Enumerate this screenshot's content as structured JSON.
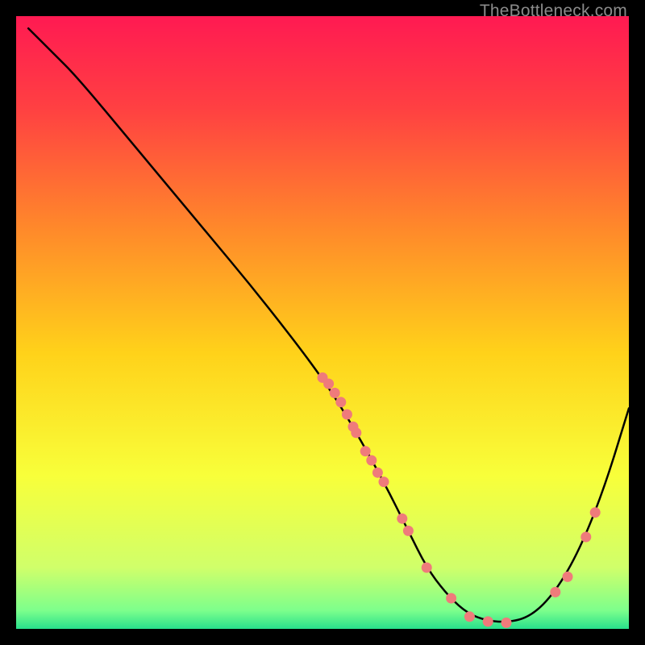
{
  "watermark": "TheBottleneck.com",
  "chart_data": {
    "type": "line",
    "title": "",
    "xlabel": "",
    "ylabel": "",
    "xlim": [
      0,
      100
    ],
    "ylim": [
      0,
      100
    ],
    "grid": false,
    "legend": "none",
    "background_gradient": {
      "stops": [
        {
          "offset": 0.0,
          "color": "#ff1a52"
        },
        {
          "offset": 0.15,
          "color": "#ff4042"
        },
        {
          "offset": 0.35,
          "color": "#ff8a2a"
        },
        {
          "offset": 0.55,
          "color": "#ffd21a"
        },
        {
          "offset": 0.75,
          "color": "#f8ff3a"
        },
        {
          "offset": 0.9,
          "color": "#d0ff6a"
        },
        {
          "offset": 0.97,
          "color": "#7dff8c"
        },
        {
          "offset": 1.0,
          "color": "#28e08c"
        }
      ]
    },
    "series": [
      {
        "name": "curve",
        "type": "line",
        "x": [
          2,
          6,
          10,
          20,
          30,
          40,
          50,
          55,
          60,
          64,
          67,
          70,
          73,
          76,
          80,
          84,
          88,
          92,
          96,
          100
        ],
        "y": [
          98,
          94,
          90,
          78,
          66,
          54,
          41,
          33,
          24,
          16,
          10,
          6,
          3,
          1.5,
          1,
          2,
          6,
          13,
          23,
          36
        ]
      },
      {
        "name": "points",
        "type": "scatter",
        "color": "#ef7b7b",
        "x": [
          50,
          51,
          52,
          53,
          54,
          55,
          55.5,
          57,
          58,
          59,
          60,
          63,
          64,
          67,
          71,
          74,
          77,
          80,
          88,
          90,
          93,
          94.5
        ],
        "y": [
          41,
          40,
          38.5,
          37,
          35,
          33,
          32,
          29,
          27.5,
          25.5,
          24,
          18,
          16,
          10,
          5,
          2,
          1.2,
          1,
          6,
          8.5,
          15,
          19
        ]
      }
    ]
  }
}
